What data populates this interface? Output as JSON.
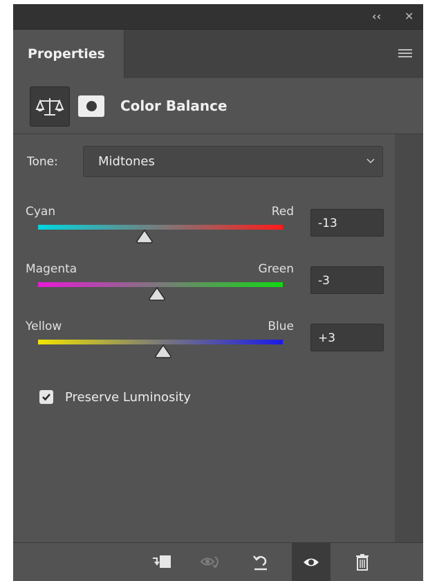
{
  "panel": {
    "tab_label": "Properties",
    "title": "Color Balance",
    "window_controls": {
      "collapse": "‹‹",
      "close": "✕"
    }
  },
  "tone": {
    "label": "Tone:",
    "selected": "Midtones"
  },
  "sliders": [
    {
      "left_label": "Cyan",
      "right_label": "Red",
      "value": "-13",
      "left_color": "#00d8e0",
      "right_color": "#ff1a1a"
    },
    {
      "left_label": "Magenta",
      "right_label": "Green",
      "value": "-3",
      "left_color": "#e81ad8",
      "right_color": "#12d812"
    },
    {
      "left_label": "Yellow",
      "right_label": "Blue",
      "value": "+3",
      "left_color": "#f0e400",
      "right_color": "#1a1ae8"
    }
  ],
  "preserve_luminosity": {
    "label": "Preserve Luminosity",
    "checked": true
  },
  "footer_icons": [
    "clip-to-layer-icon",
    "view-previous-state-icon",
    "reset-icon",
    "toggle-visibility-icon",
    "delete-icon"
  ]
}
